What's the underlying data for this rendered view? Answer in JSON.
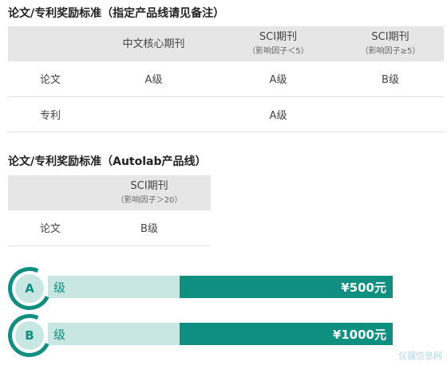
{
  "section1": {
    "title": "论文/专利奖励标准（指定产品线请见备注）",
    "headers": [
      {
        "main": "",
        "sub": ""
      },
      {
        "main": "中文核心期刊",
        "sub": ""
      },
      {
        "main": "SCI期刊",
        "sub": "（影响因子＜5）"
      },
      {
        "main": "SCI期刊",
        "sub": "（影响因子≥5）"
      }
    ],
    "rows": [
      {
        "label": "论文",
        "cells": [
          "A级",
          "A级",
          "B级"
        ]
      },
      {
        "label": "专利",
        "cells": [
          "",
          "A级",
          ""
        ]
      }
    ]
  },
  "section2": {
    "title": "论文/专利奖励标准（Autolab产品线）",
    "headers": [
      {
        "main": "",
        "sub": ""
      },
      {
        "main": "SCI期刊",
        "sub": "（影响因子＞20）"
      }
    ],
    "rows": [
      {
        "label": "论文",
        "cells": [
          "B级"
        ]
      }
    ]
  },
  "rewards": [
    {
      "letter": "A",
      "grade": "级",
      "amount": "¥500元"
    },
    {
      "letter": "B",
      "grade": "级",
      "amount": "¥1000元"
    }
  ],
  "watermark": "仪器信息网",
  "colors": {
    "accent": "#0f8f7f",
    "accent_light": "#c8e6e2",
    "header_bg": "#e6e6e6"
  }
}
